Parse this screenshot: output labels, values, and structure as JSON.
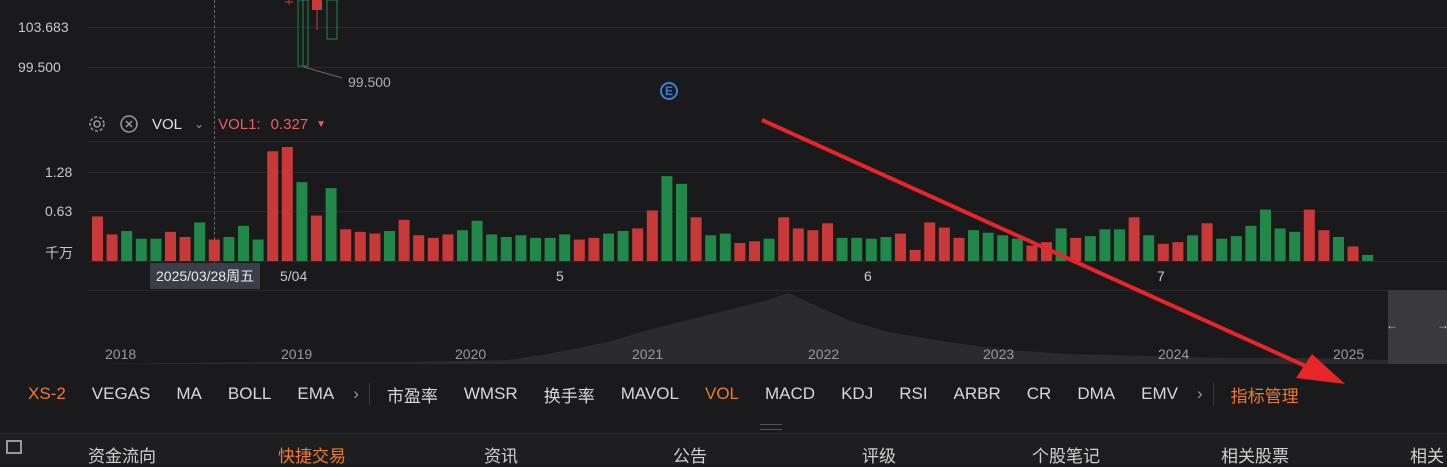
{
  "price_axis": {
    "labels": [
      "103.683",
      "99.500"
    ]
  },
  "candle_annotation": "99.500",
  "event_badge": "E",
  "indicator_bar": {
    "name": "VOL",
    "series_label": "VOL1:",
    "series_value": "0.327"
  },
  "volume_axis": {
    "labels": [
      "1.28",
      "0.63",
      "千万"
    ]
  },
  "crosshair_date": "2025/03/28周五",
  "month_labels": [
    "5/04",
    "5",
    "6",
    "7"
  ],
  "year_labels": [
    "2018",
    "2019",
    "2020",
    "2021",
    "2022",
    "2023",
    "2024",
    "2025"
  ],
  "overview_arrows": [
    "←",
    "→"
  ],
  "indicator_tabs": {
    "main": [
      "XS-2",
      "VEGAS",
      "MA",
      "BOLL",
      "EMA"
    ],
    "sub": [
      "市盈率",
      "WMSR",
      "换手率",
      "MAVOL",
      "VOL",
      "MACD",
      "KDJ",
      "RSI",
      "ARBR",
      "CR",
      "DMA",
      "EMV"
    ],
    "manage": "指标管理"
  },
  "bottom_tabs": [
    "资金流向",
    "快捷交易",
    "资讯",
    "公告",
    "评级",
    "个股笔记",
    "相关股票",
    "相关"
  ],
  "colors": {
    "up": "#c83a3a",
    "down": "#22884a",
    "accent": "#f07a2a",
    "arrow": "#e8262a"
  },
  "chart_data": {
    "type": "bar",
    "ylabel": "千万",
    "series": [
      {
        "values": [
          0.52,
          0.31,
          0.35,
          0.26,
          0.26,
          0.34,
          0.28,
          0.45,
          0.25,
          0.28,
          0.41,
          0.25,
          1.28,
          1.33,
          0.92,
          0.53,
          0.85,
          0.37,
          0.34,
          0.32,
          0.35,
          0.48,
          0.3,
          0.27,
          0.31,
          0.36,
          0.47,
          0.31,
          0.28,
          0.3,
          0.27,
          0.27,
          0.31,
          0.25,
          0.27,
          0.32,
          0.35,
          0.38,
          0.59,
          0.99,
          0.9,
          0.51,
          0.3,
          0.32,
          0.21,
          0.23,
          0.26,
          0.51,
          0.38,
          0.36,
          0.44,
          0.27,
          0.27,
          0.26,
          0.28,
          0.32,
          0.13,
          0.45,
          0.39,
          0.27,
          0.36,
          0.33,
          0.3,
          0.26,
          0.18,
          0.22,
          0.38,
          0.27,
          0.29,
          0.37,
          0.37,
          0.51,
          0.3,
          0.2,
          0.22,
          0.3,
          0.44,
          0.26,
          0.29,
          0.41,
          0.6,
          0.38,
          0.34,
          0.6,
          0.36,
          0.28,
          0.17,
          0.07
        ]
      }
    ],
    "colors_up_down": [
      "u",
      "u",
      "d",
      "d",
      "d",
      "u",
      "u",
      "d",
      "u",
      "d",
      "d",
      "d",
      "u",
      "u",
      "d",
      "u",
      "d",
      "u",
      "u",
      "u",
      "d",
      "u",
      "u",
      "u",
      "u",
      "d",
      "d",
      "d",
      "d",
      "d",
      "d",
      "d",
      "d",
      "u",
      "u",
      "d",
      "d",
      "u",
      "u",
      "d",
      "d",
      "u",
      "d",
      "d",
      "u",
      "u",
      "d",
      "u",
      "u",
      "u",
      "u",
      "d",
      "d",
      "d",
      "d",
      "u",
      "u",
      "u",
      "u",
      "u",
      "d",
      "d",
      "d",
      "d",
      "u",
      "u",
      "d",
      "u",
      "d",
      "d",
      "d",
      "u",
      "d",
      "u",
      "u",
      "d",
      "u",
      "d",
      "d",
      "d",
      "d",
      "d",
      "d",
      "u",
      "u",
      "d",
      "u",
      "d"
    ],
    "ylim": [
      0,
      1.4
    ]
  }
}
